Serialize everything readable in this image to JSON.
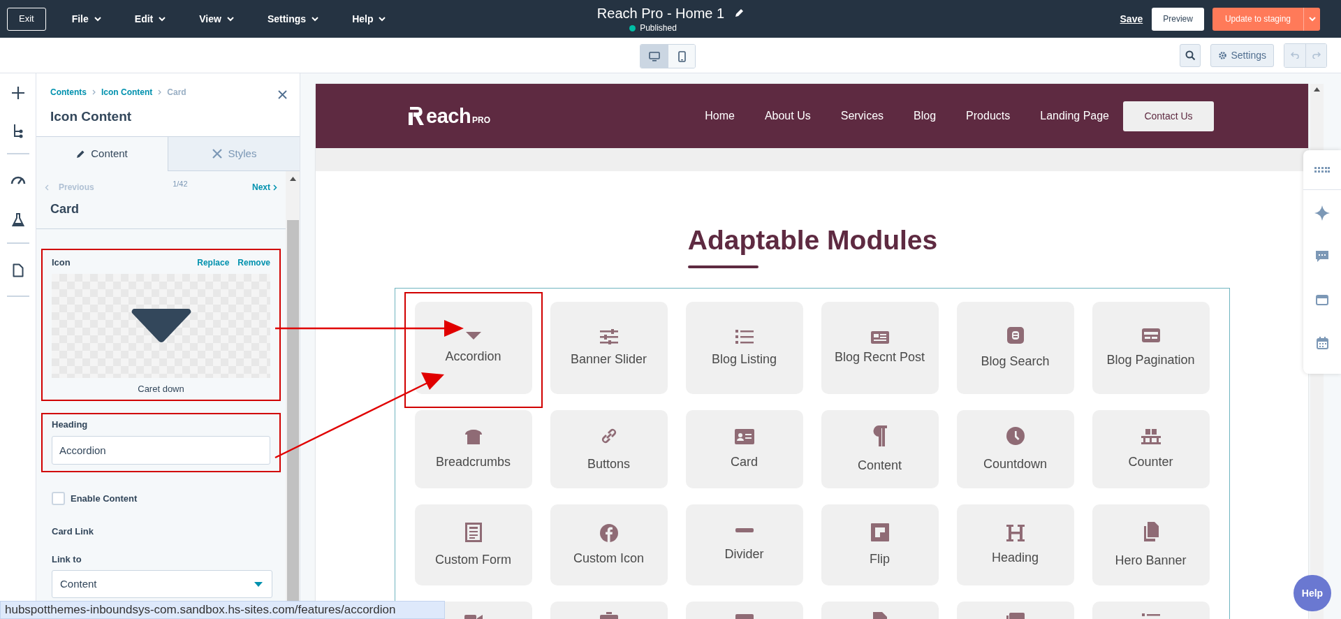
{
  "top_bar": {
    "exit": "Exit",
    "menus": [
      {
        "label": "File"
      },
      {
        "label": "Edit"
      },
      {
        "label": "View"
      },
      {
        "label": "Settings"
      },
      {
        "label": "Help"
      }
    ],
    "title": "Reach Pro - Home 1",
    "status": "Published",
    "save": "Save",
    "preview": "Preview",
    "publish": "Update to staging"
  },
  "toolbar": {
    "devices": [
      {
        "kind": "desktop",
        "selected": true
      },
      {
        "kind": "mobile",
        "selected": false
      }
    ],
    "settings": "Settings"
  },
  "panel": {
    "breadcrumbs": [
      {
        "label": "Contents",
        "current": false
      },
      {
        "label": "Icon Content",
        "current": false
      },
      {
        "label": "Card",
        "current": true
      }
    ],
    "title": "Icon Content",
    "tabs": [
      {
        "label": "Content",
        "kind": "pencil",
        "selected": true
      },
      {
        "label": "Styles",
        "kind": "brush",
        "selected": false
      }
    ],
    "pager": {
      "previous": "Previous",
      "previous_disabled": true,
      "count": "1/42",
      "next": "Next"
    },
    "section_title": "Card",
    "icon_field": {
      "label": "Icon",
      "replace": "Replace",
      "remove": "Remove",
      "caption": "Caret down"
    },
    "heading_field": {
      "label": "Heading",
      "value": "Accordion"
    },
    "enable_content": {
      "label": "Enable Content",
      "checked": false
    },
    "card_link": {
      "title": "Card Link",
      "label": "Link to",
      "value": "Content"
    }
  },
  "site": {
    "logo": "each",
    "logo_suffix": "PRO",
    "nav": [
      "Home",
      "About Us",
      "Services",
      "Blog",
      "Products",
      "Landing Page"
    ],
    "cta": "Contact Us",
    "heading": "Adaptable Modules",
    "modules": [
      {
        "label": "Accordion",
        "highlighted": true
      },
      {
        "label": "Banner Slider",
        "highlighted": false
      },
      {
        "label": "Blog Listing",
        "highlighted": false
      },
      {
        "label": "Blog Recnt Post",
        "highlighted": false
      },
      {
        "label": "Blog Search",
        "highlighted": false
      },
      {
        "label": "Blog Pagination",
        "highlighted": false
      },
      {
        "label": "Breadcrumbs",
        "highlighted": false
      },
      {
        "label": "Buttons",
        "highlighted": false
      },
      {
        "label": "Card",
        "highlighted": false
      },
      {
        "label": "Content",
        "highlighted": false
      },
      {
        "label": "Countdown",
        "highlighted": false
      },
      {
        "label": "Counter",
        "highlighted": false
      },
      {
        "label": "Custom Form",
        "highlighted": false
      },
      {
        "label": "Custom Icon",
        "highlighted": false
      },
      {
        "label": "Divider",
        "highlighted": false
      },
      {
        "label": "Flip",
        "highlighted": false
      },
      {
        "label": "Heading",
        "highlighted": false
      },
      {
        "label": "Hero Banner",
        "highlighted": false
      }
    ],
    "cut_row": [
      {
        "kind": "video"
      },
      {
        "kind": "briefcase"
      },
      {
        "kind": "image"
      },
      {
        "kind": "file"
      },
      {
        "kind": "images"
      },
      {
        "kind": "list"
      }
    ]
  },
  "status_url": "hubspotthemes-inboundsys-com.sandbox.hs-sites.com/features/accordion",
  "help": "Help"
}
